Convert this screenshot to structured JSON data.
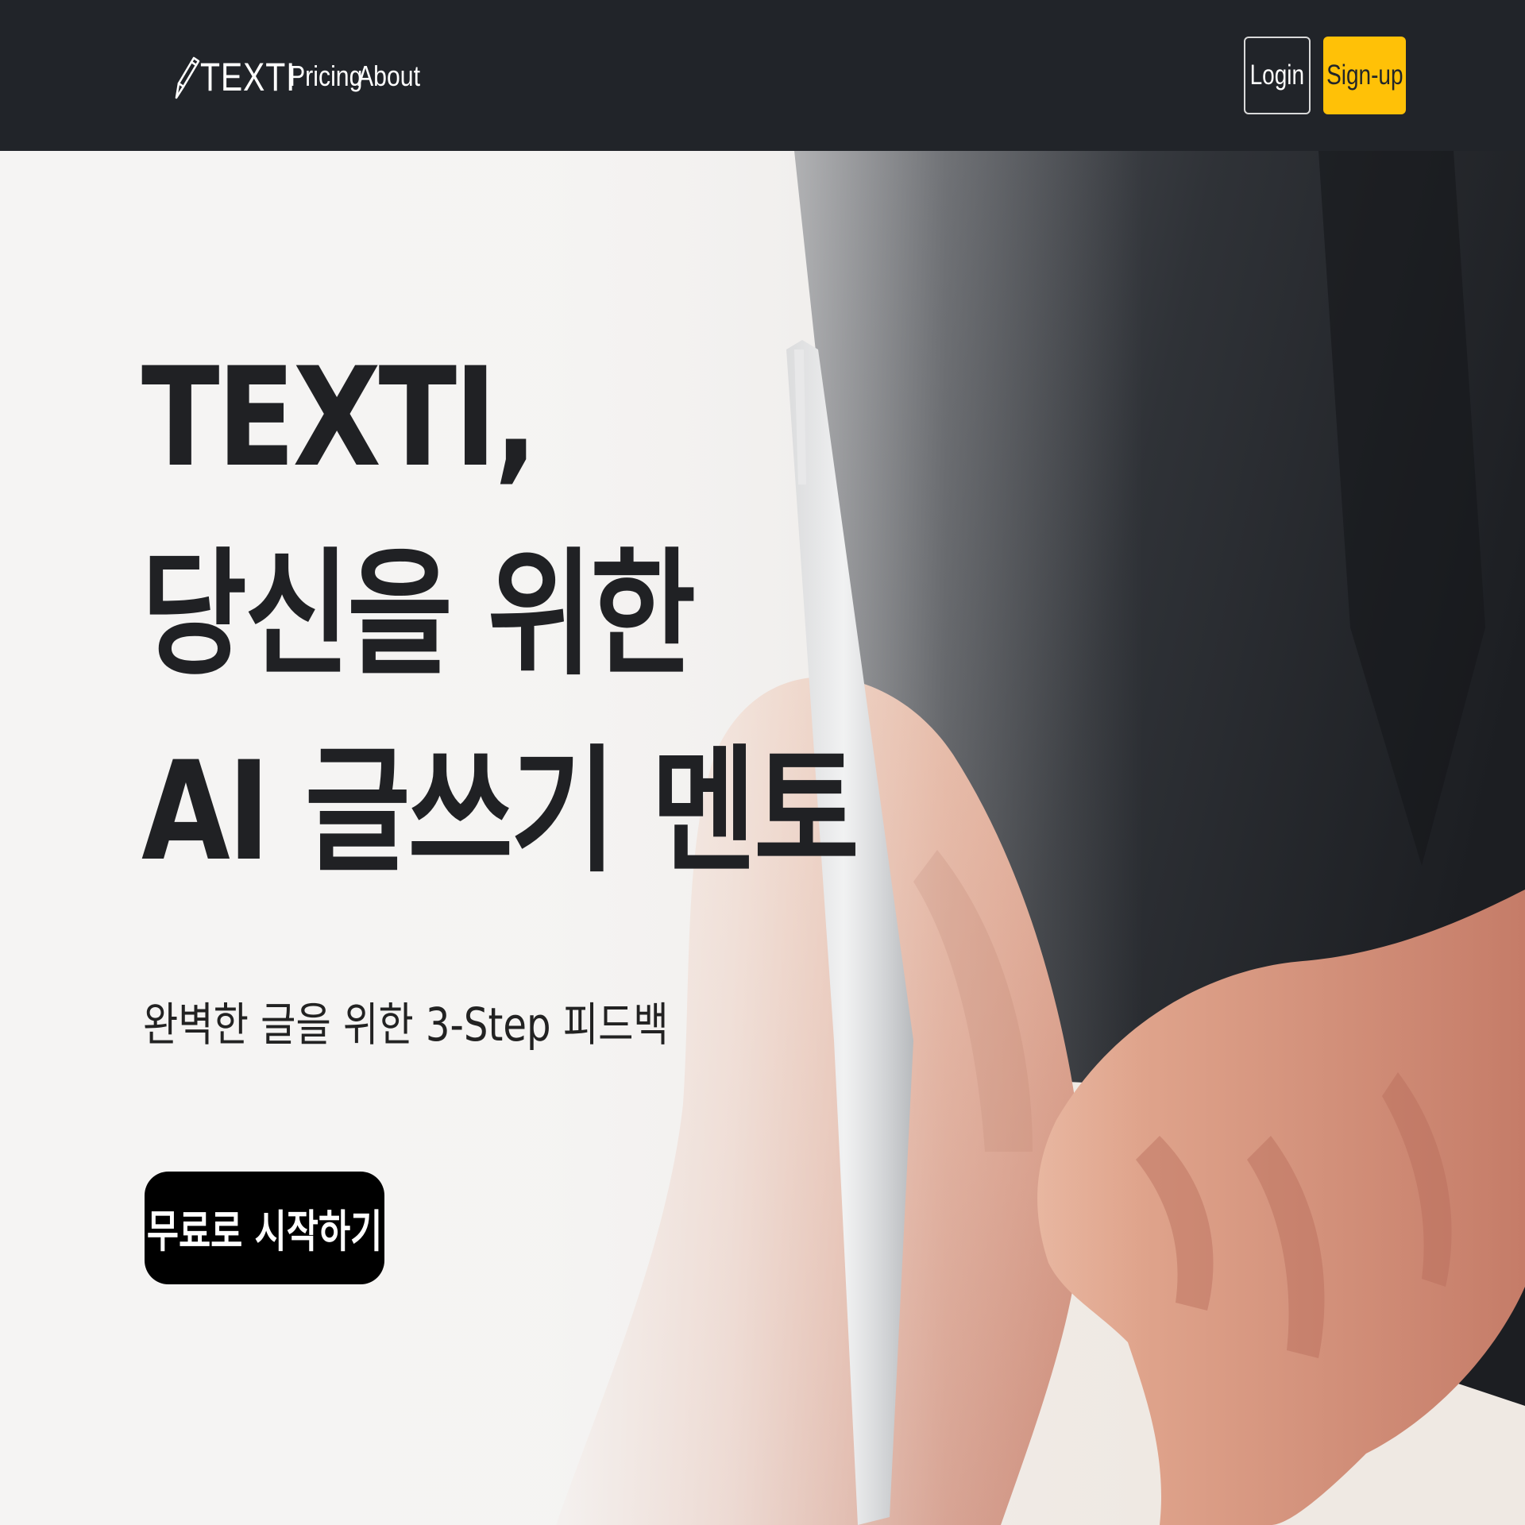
{
  "navbar": {
    "brand": {
      "icon": "pencil-icon",
      "text": "TEXTI"
    },
    "links": [
      {
        "label": "Pricing"
      },
      {
        "label": "About"
      }
    ],
    "login_label": "Login",
    "signup_label": "Sign-up",
    "colors": {
      "background": "#212429",
      "signup": "#ffc107"
    }
  },
  "hero": {
    "title_lines": [
      "TEXTI,",
      "당신을 위한",
      "AI 글쓰기 멘토"
    ],
    "subtitle": "완벽한 글을 위한 3-Step 피드백",
    "cta_label": "무료로 시작하기",
    "background_image": "hands writing with a pen on paper, fading to white on the left"
  }
}
